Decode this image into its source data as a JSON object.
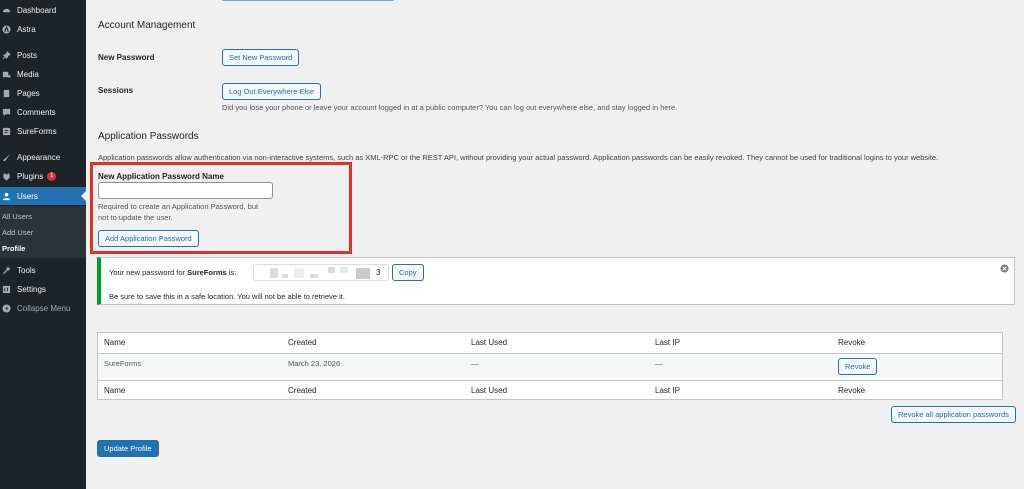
{
  "sidebar": {
    "items": [
      {
        "label": "Dashboard",
        "icon": "dashboard-icon"
      },
      {
        "label": "Astra",
        "icon": "astra-icon"
      },
      {
        "label": "Posts",
        "icon": "pin-icon"
      },
      {
        "label": "Media",
        "icon": "media-icon"
      },
      {
        "label": "Pages",
        "icon": "pages-icon"
      },
      {
        "label": "Comments",
        "icon": "comment-icon"
      },
      {
        "label": "SureForms",
        "icon": "sureforms-icon"
      },
      {
        "label": "Appearance",
        "icon": "brush-icon"
      },
      {
        "label": "Plugins",
        "icon": "plugin-icon",
        "badge": "1"
      },
      {
        "label": "Users",
        "icon": "users-icon",
        "current": true
      },
      {
        "label": "Tools",
        "icon": "wrench-icon"
      },
      {
        "label": "Settings",
        "icon": "settings-icon"
      },
      {
        "label": "Collapse Menu",
        "icon": "collapse-icon"
      }
    ],
    "submenu": [
      "All Users",
      "Add User",
      "Profile"
    ]
  },
  "account": {
    "heading": "Account Management",
    "new_password_label": "New Password",
    "set_password_button": "Set New Password",
    "sessions_label": "Sessions",
    "logout_button": "Log Out Everywhere Else",
    "logout_desc": "Did you lose your phone or leave your account logged in at a public computer? You can log out everywhere else, and stay logged in here."
  },
  "apppw": {
    "heading": "Application Passwords",
    "desc": "Application passwords allow authentication via non-interactive systems, such as XML-RPC or the REST API, without providing your actual password. Application passwords can be easily revoked. They cannot be used for traditional logins to your website.",
    "name_label": "New Application Password Name",
    "name_value": "",
    "help_line1": "Required to create an Application Password, but",
    "help_line2": "not to update the user.",
    "add_button": "Add Application Password"
  },
  "notice": {
    "prefix": "Your new password for",
    "app": "SureForms",
    "suffix": "is:",
    "password_tail": "3",
    "copy_button": "Copy",
    "warning": "Be sure to save this in a safe location. You will not be able to retrieve it."
  },
  "table": {
    "headers": [
      "Name",
      "Created",
      "Last Used",
      "Last IP",
      "Revoke"
    ],
    "rows": [
      [
        "SureForms",
        "March 23, 2026",
        "—",
        "—",
        "Revoke"
      ]
    ]
  },
  "revoke_all_button": "Revoke all application passwords",
  "update_button": "Update Profile",
  "colors": {
    "accent": "#2271b1",
    "sidebar": "#1d2327",
    "highlight": "#e0322b",
    "success": "#00a32a"
  }
}
